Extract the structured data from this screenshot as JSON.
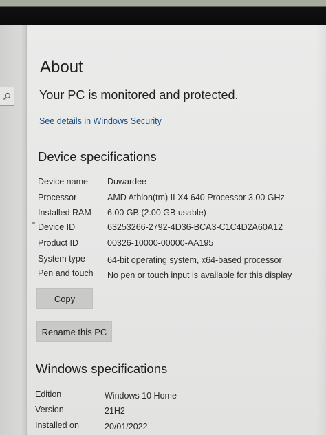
{
  "page": {
    "title": "About",
    "protection_status": "Your PC is monitored and protected.",
    "security_link": "See details in Windows Security"
  },
  "device_specs": {
    "heading": "Device specifications",
    "rows": [
      {
        "label": "Device name",
        "value": "Duwardee"
      },
      {
        "label": "Processor",
        "value": "AMD Athlon(tm) II X4 640 Processor   3.00 GHz"
      },
      {
        "label": "Installed RAM",
        "value": "6.00 GB (2.00 GB usable)"
      },
      {
        "label": "Device ID",
        "value": "63253266-2792-4D36-BCA3-C1C4D2A60A12"
      },
      {
        "label": "Product ID",
        "value": "00326-10000-00000-AA195"
      },
      {
        "label": "System type",
        "value": "64-bit operating system, x64-based processor"
      },
      {
        "label": "Pen and touch",
        "value": "No pen or touch input is available for this display"
      }
    ],
    "copy_button": "Copy",
    "rename_button": "Rename this PC"
  },
  "windows_specs": {
    "heading": "Windows specifications",
    "rows": [
      {
        "label": "Edition",
        "value": "Windows 10 Home"
      },
      {
        "label": "Version",
        "value": "21H2"
      },
      {
        "label": "Installed on",
        "value": "20/01/2022"
      }
    ]
  },
  "icons": {
    "search": "search-icon"
  },
  "colors": {
    "link": "#1a4f8a",
    "button_bg": "#c9c9c8",
    "page_bg": "#ebebea"
  }
}
